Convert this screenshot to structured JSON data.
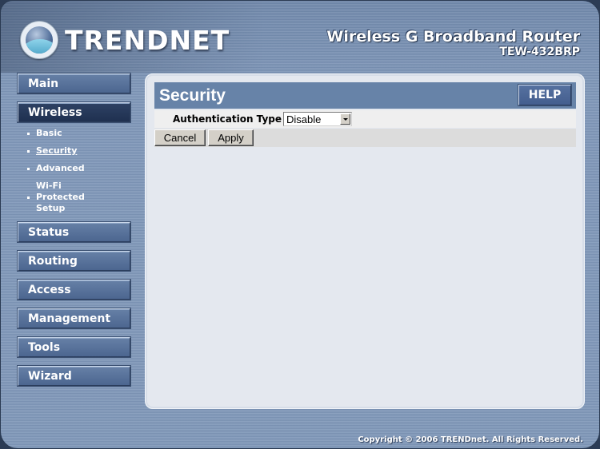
{
  "header": {
    "brand": "TRENDNET",
    "product_title": "Wireless G Broadband Router",
    "model": "TEW-432BRP"
  },
  "sidebar": {
    "items": [
      {
        "label": "Main",
        "active": false
      },
      {
        "label": "Wireless",
        "active": true,
        "subitems": [
          {
            "label": "Basic"
          },
          {
            "label": "Security",
            "current": true
          },
          {
            "label": "Advanced"
          },
          {
            "label": "Wi-Fi Protected Setup"
          }
        ]
      },
      {
        "label": "Status",
        "active": false
      },
      {
        "label": "Routing",
        "active": false
      },
      {
        "label": "Access",
        "active": false
      },
      {
        "label": "Management",
        "active": false
      },
      {
        "label": "Tools",
        "active": false
      },
      {
        "label": "Wizard",
        "active": false
      }
    ]
  },
  "main": {
    "title": "Security",
    "help_label": "HELP",
    "auth_type": {
      "label": "Authentication Type",
      "value": "Disable"
    },
    "buttons": {
      "cancel": "Cancel",
      "apply": "Apply"
    }
  },
  "footer": {
    "copyright": "Copyright © 2006 TRENDnet. All Rights Reserved."
  },
  "colors": {
    "frame": "#7e96b8",
    "panel": "#e4e8ef",
    "panel_header": "#6783a8",
    "nav_active": "#1f3050"
  }
}
